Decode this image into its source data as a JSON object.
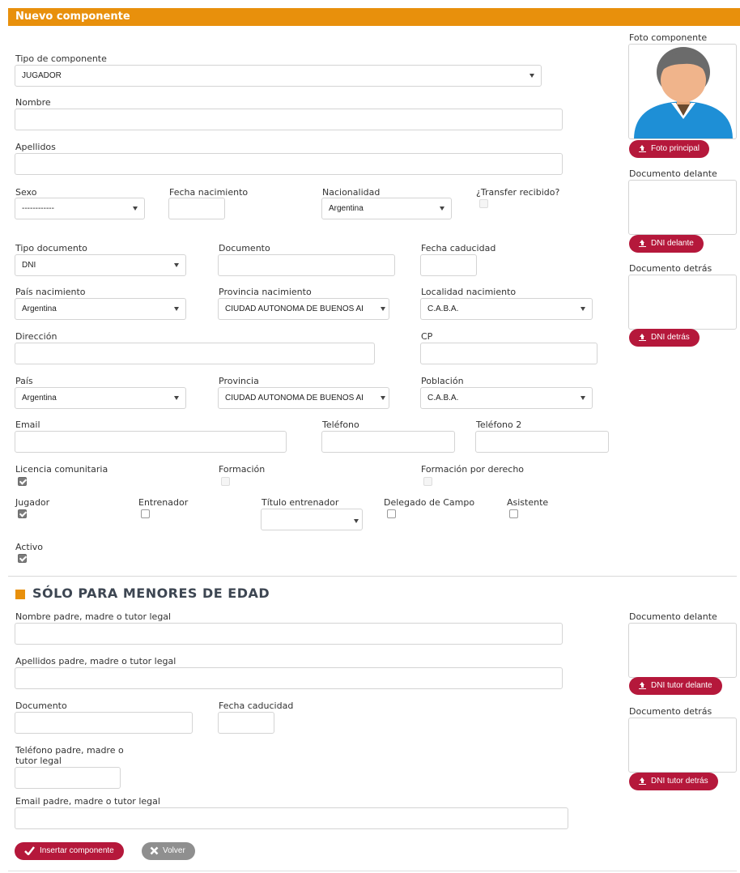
{
  "header": {
    "title": "Nuevo componente"
  },
  "form": {
    "tipo_componente": {
      "label": "Tipo de componente",
      "value": "JUGADOR"
    },
    "nombre": {
      "label": "Nombre",
      "value": ""
    },
    "apellidos": {
      "label": "Apellidos",
      "value": ""
    },
    "sexo": {
      "label": "Sexo",
      "value": "------------"
    },
    "fecha_nacimiento": {
      "label": "Fecha nacimiento",
      "value": ""
    },
    "nacionalidad": {
      "label": "Nacionalidad",
      "value": "Argentina"
    },
    "transfer": {
      "label": "¿Transfer recibido?",
      "checked": false
    },
    "tipo_documento": {
      "label": "Tipo documento",
      "value": "DNI"
    },
    "documento": {
      "label": "Documento",
      "value": ""
    },
    "fecha_caducidad": {
      "label": "Fecha caducidad",
      "value": ""
    },
    "pais_nacimiento": {
      "label": "País nacimiento",
      "value": "Argentina"
    },
    "provincia_nacimiento": {
      "label": "Provincia nacimiento",
      "value": "CIUDAD AUTONOMA DE BUENOS AI"
    },
    "localidad_nacimiento": {
      "label": "Localidad nacimiento",
      "value": "C.A.B.A."
    },
    "direccion": {
      "label": "Dirección",
      "value": ""
    },
    "cp": {
      "label": "CP",
      "value": ""
    },
    "pais": {
      "label": "País",
      "value": "Argentina"
    },
    "provincia": {
      "label": "Provincia",
      "value": "CIUDAD AUTONOMA DE BUENOS AI"
    },
    "poblacion": {
      "label": "Población",
      "value": "C.A.B.A."
    },
    "email": {
      "label": "Email",
      "value": ""
    },
    "telefono": {
      "label": "Teléfono",
      "value": ""
    },
    "telefono2": {
      "label": "Teléfono 2",
      "value": ""
    },
    "licencia": {
      "label": "Licencia comunitaria",
      "checked": true
    },
    "formacion": {
      "label": "Formación",
      "checked": false
    },
    "formacion_derecho": {
      "label": "Formación por derecho",
      "checked": false
    },
    "jugador": {
      "label": "Jugador",
      "checked": true
    },
    "entrenador": {
      "label": "Entrenador",
      "checked": false
    },
    "titulo_entrenador": {
      "label": "Título entrenador",
      "value": ""
    },
    "delegado": {
      "label": "Delegado de Campo",
      "checked": false
    },
    "asistente": {
      "label": "Asistente",
      "checked": false
    },
    "activo": {
      "label": "Activo",
      "checked": true
    }
  },
  "sidebar": {
    "foto_label": "Foto componente",
    "foto_button": "Foto principal",
    "doc_delante_label": "Documento delante",
    "doc_delante_button": "DNI delante",
    "doc_detras_label": "Documento detrás",
    "doc_detras_button": "DNI detrás"
  },
  "minors": {
    "title": "SÓLO PARA MENORES DE EDAD",
    "nombre_tutor": "Nombre padre, madre o tutor legal",
    "apellidos_tutor": "Apellidos padre, madre o tutor legal",
    "documento": "Documento",
    "fecha_caducidad": "Fecha caducidad",
    "telefono_line1": "Teléfono padre, madre o",
    "telefono_line2": "tutor legal",
    "email_tutor": "Email padre, madre o tutor legal",
    "doc_delante_label": "Documento delante",
    "doc_delante_button": "DNI tutor delante",
    "doc_detras_label": "Documento detrás",
    "doc_detras_button": "DNI tutor detrás"
  },
  "actions": {
    "insert": "Insertar componente",
    "back": "Volver"
  },
  "colors": {
    "header": "#e8900c",
    "button_red": "#b5183b",
    "button_grey": "#8f8f8f",
    "avatar_shirt": "#1e8fd6"
  },
  "icons": [
    "upload-icon",
    "check-icon",
    "close-icon",
    "avatar-placeholder"
  ]
}
